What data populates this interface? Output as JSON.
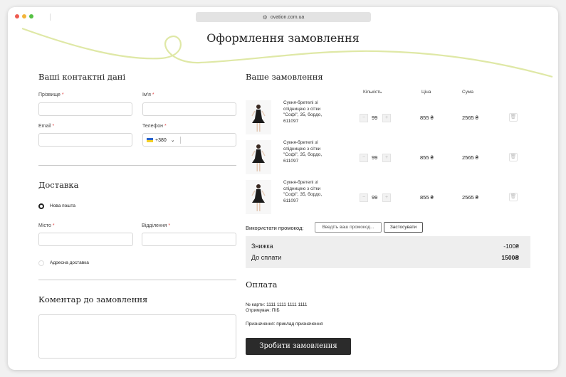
{
  "browser": {
    "url": "ovation.com.ua"
  },
  "page": {
    "title": "Оформлення замовлення"
  },
  "contact": {
    "heading": "Ваші контактні дані",
    "surname_label": "Прізвище",
    "name_label": "Ім'я",
    "email_label": "Email",
    "phone_label": "Телефон",
    "phone_code": "+380",
    "required_mark": "*"
  },
  "delivery": {
    "heading": "Доставка",
    "option_post": "Нова пошта",
    "city_label": "Місто",
    "branch_label": "Відділення",
    "option_address": "Адресна доставка"
  },
  "comment": {
    "heading": "Коментар до замовлення"
  },
  "order": {
    "heading": "Ваше замовлення",
    "col_qty": "Кількість",
    "col_price": "Ціна",
    "col_sum": "Сума",
    "items": [
      {
        "name": "Сукня-бретелі зі спідницею з сітки \"Софі\", 35, бордо, 611097",
        "qty": "99",
        "price": "855 ₴",
        "sum": "2565 ₴"
      },
      {
        "name": "Сукня-бретелі зі спідницею з сітки \"Софі\", 35, бордо, 611097",
        "qty": "99",
        "price": "855 ₴",
        "sum": "2565 ₴"
      },
      {
        "name": "Сукня-бретелі зі спідницею з сітки \"Софі\", 35, бордо, 611097",
        "qty": "99",
        "price": "855 ₴",
        "sum": "2565 ₴"
      }
    ],
    "promo_label": "Використати промокод:",
    "promo_placeholder": "Введіть ваш промокод...",
    "promo_apply": "Застосувати",
    "discount_label": "Знижка",
    "discount_value": "-100₴",
    "total_label": "До сплати",
    "total_value": "1500₴"
  },
  "payment": {
    "heading": "Оплата",
    "card_line": "№ карти: 1111 1111 1111 1111",
    "recipient_line": "Отримувач: ПІБ",
    "purpose_line": "Призначення: приклад призначення",
    "submit_label": "Зробити замовлення"
  },
  "colors": {
    "accent_swirl": "#dfe8a6",
    "required": "#e14b4b",
    "button_dark": "#2b2b2b"
  }
}
